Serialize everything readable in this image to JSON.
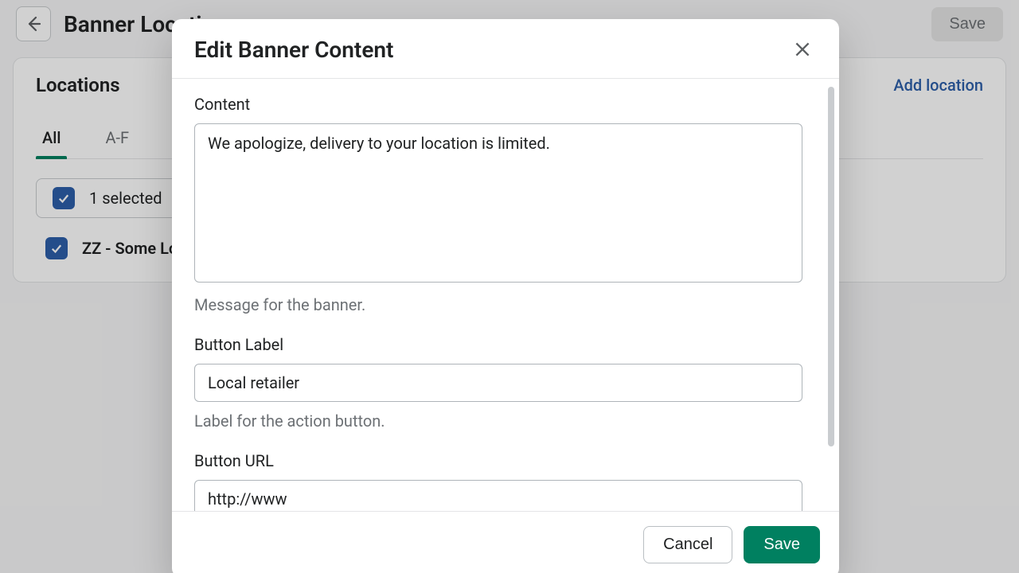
{
  "page": {
    "title": "Banner Locations",
    "save_label": "Save"
  },
  "card": {
    "title": "Locations",
    "add_link": "Add location",
    "tabs": {
      "all": "All",
      "af": "A-F"
    },
    "selection_text": "1 selected",
    "item_label": "ZZ - Some Location"
  },
  "modal": {
    "title": "Edit Banner Content",
    "content_label": "Content",
    "content_value": "We apologize, delivery to your location is limited.",
    "content_help": "Message for the banner.",
    "button_label_label": "Button Label",
    "button_label_value": "Local retailer",
    "button_label_help": "Label for the action button.",
    "button_url_label": "Button URL",
    "button_url_value": "http://www",
    "cancel_label": "Cancel",
    "save_label": "Save"
  }
}
